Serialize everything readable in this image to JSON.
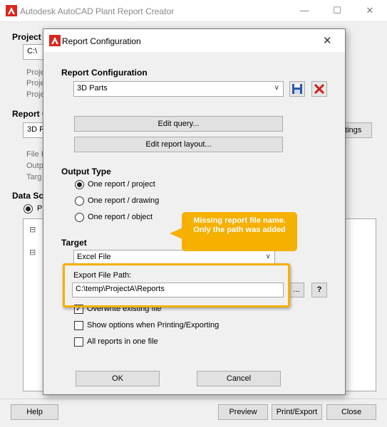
{
  "app": {
    "title": "Autodesk AutoCAD Plant Report Creator",
    "controls": {
      "minimize": "—",
      "maximize": "☐",
      "close": "✕"
    }
  },
  "main": {
    "project_label": "Project",
    "project_value": "C:\\",
    "project_rows": [
      "Proje",
      "Proje",
      "Proje"
    ],
    "report_label": "Report C",
    "report_value": "3D P",
    "settings_button": "ttings",
    "file_rows": [
      "File F",
      "Outp",
      "Targ"
    ],
    "datasource_label": "Data Sc",
    "datasource_radio": "P",
    "tree_expanders": [
      "⊟",
      "⊟"
    ],
    "footer": {
      "help": "Help",
      "preview": "Preview",
      "print_export": "Print/Export",
      "close": "Close"
    }
  },
  "dialog": {
    "title": "Report Configuration",
    "close": "✕",
    "section_report": "Report Configuration",
    "report_combo": "3D Parts",
    "edit_query": "Edit query...",
    "edit_layout": "Edit report layout...",
    "section_output": "Output Type",
    "output_options": [
      {
        "label": "One report / project",
        "selected": true
      },
      {
        "label": "One report / drawing",
        "selected": false
      },
      {
        "label": "One report / object",
        "selected": false
      }
    ],
    "section_target": "Target",
    "target_combo": "Excel File",
    "export_label": "Export File Path:",
    "export_value": "C:\\temp\\ProjectA\\Reports",
    "browse_button": "...",
    "help_button": "?",
    "checkboxes": [
      {
        "label": "Overwrite existing file",
        "checked": true
      },
      {
        "label": "Show options when Printing/Exporting",
        "checked": false
      },
      {
        "label": "All reports in one file",
        "checked": false
      }
    ],
    "ok": "OK",
    "cancel": "Cancel"
  },
  "callout": {
    "text": "Missing report file name. Only the path was added",
    "color": "#f5b000"
  },
  "colors": {
    "autodesk_red": "#d9281e",
    "save_blue": "#2b5aa8",
    "delete_red": "#d01f1f"
  }
}
